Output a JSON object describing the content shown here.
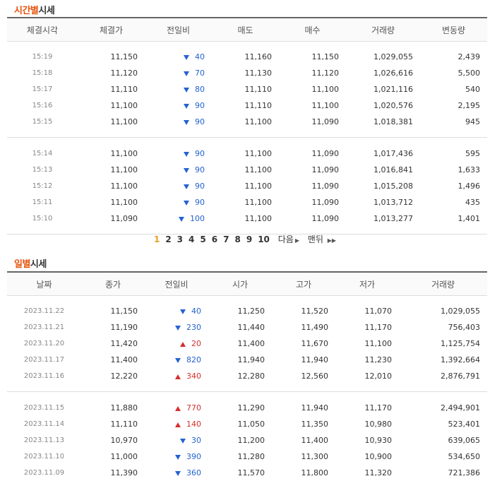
{
  "time_section": {
    "title_accent": "시간별",
    "title_rest": "시세",
    "headers": [
      "체결시각",
      "체결가",
      "전일비",
      "매도",
      "매수",
      "거래량",
      "변동량"
    ],
    "group1": [
      {
        "time": "15:19",
        "price": "11,150",
        "dir": "down",
        "change": "40",
        "ask": "11,160",
        "bid": "11,150",
        "volume": "1,029,055",
        "vchange": "2,439"
      },
      {
        "time": "15:18",
        "price": "11,120",
        "dir": "down",
        "change": "70",
        "ask": "11,130",
        "bid": "11,120",
        "volume": "1,026,616",
        "vchange": "5,500"
      },
      {
        "time": "15:17",
        "price": "11,110",
        "dir": "down",
        "change": "80",
        "ask": "11,110",
        "bid": "11,100",
        "volume": "1,021,116",
        "vchange": "540"
      },
      {
        "time": "15:16",
        "price": "11,100",
        "dir": "down",
        "change": "90",
        "ask": "11,110",
        "bid": "11,100",
        "volume": "1,020,576",
        "vchange": "2,195"
      },
      {
        "time": "15:15",
        "price": "11,100",
        "dir": "down",
        "change": "90",
        "ask": "11,100",
        "bid": "11,090",
        "volume": "1,018,381",
        "vchange": "945"
      }
    ],
    "group2": [
      {
        "time": "15:14",
        "price": "11,100",
        "dir": "down",
        "change": "90",
        "ask": "11,100",
        "bid": "11,090",
        "volume": "1,017,436",
        "vchange": "595"
      },
      {
        "time": "15:13",
        "price": "11,100",
        "dir": "down",
        "change": "90",
        "ask": "11,100",
        "bid": "11,090",
        "volume": "1,016,841",
        "vchange": "1,633"
      },
      {
        "time": "15:12",
        "price": "11,100",
        "dir": "down",
        "change": "90",
        "ask": "11,100",
        "bid": "11,090",
        "volume": "1,015,208",
        "vchange": "1,496"
      },
      {
        "time": "15:11",
        "price": "11,100",
        "dir": "down",
        "change": "90",
        "ask": "11,100",
        "bid": "11,090",
        "volume": "1,013,712",
        "vchange": "435"
      },
      {
        "time": "15:10",
        "price": "11,090",
        "dir": "down",
        "change": "100",
        "ask": "11,100",
        "bid": "11,090",
        "volume": "1,013,277",
        "vchange": "1,401"
      }
    ]
  },
  "pager": {
    "pages": [
      "1",
      "2",
      "3",
      "4",
      "5",
      "6",
      "7",
      "8",
      "9",
      "10"
    ],
    "current": "1",
    "next_label": "다음",
    "last_label": "맨뒤",
    "next_icon": "triangle-right-icon",
    "last_icon": "double-triangle-right-icon"
  },
  "daily_section": {
    "title_accent": "일별",
    "title_rest": "시세",
    "headers": [
      "날짜",
      "종가",
      "전일비",
      "시가",
      "고가",
      "저가",
      "거래량"
    ],
    "group1": [
      {
        "date": "2023.11.22",
        "close": "11,150",
        "dir": "down",
        "change": "40",
        "open": "11,250",
        "high": "11,520",
        "low": "11,070",
        "volume": "1,029,055"
      },
      {
        "date": "2023.11.21",
        "close": "11,190",
        "dir": "down",
        "change": "230",
        "open": "11,440",
        "high": "11,490",
        "low": "11,170",
        "volume": "756,403"
      },
      {
        "date": "2023.11.20",
        "close": "11,420",
        "dir": "up",
        "change": "20",
        "open": "11,400",
        "high": "11,670",
        "low": "11,100",
        "volume": "1,125,754"
      },
      {
        "date": "2023.11.17",
        "close": "11,400",
        "dir": "down",
        "change": "820",
        "open": "11,940",
        "high": "11,940",
        "low": "11,230",
        "volume": "1,392,664"
      },
      {
        "date": "2023.11.16",
        "close": "12,220",
        "dir": "up",
        "change": "340",
        "open": "12,280",
        "high": "12,560",
        "low": "12,010",
        "volume": "2,876,791"
      }
    ],
    "group2": [
      {
        "date": "2023.11.15",
        "close": "11,880",
        "dir": "up",
        "change": "770",
        "open": "11,290",
        "high": "11,940",
        "low": "11,170",
        "volume": "2,494,901"
      },
      {
        "date": "2023.11.14",
        "close": "11,110",
        "dir": "up",
        "change": "140",
        "open": "11,050",
        "high": "11,350",
        "low": "10,980",
        "volume": "523,401"
      },
      {
        "date": "2023.11.13",
        "close": "10,970",
        "dir": "down",
        "change": "30",
        "open": "11,200",
        "high": "11,400",
        "low": "10,930",
        "volume": "639,065"
      },
      {
        "date": "2023.11.10",
        "close": "11,000",
        "dir": "down",
        "change": "390",
        "open": "11,280",
        "high": "11,300",
        "low": "10,900",
        "volume": "534,650"
      },
      {
        "date": "2023.11.09",
        "close": "11,390",
        "dir": "down",
        "change": "360",
        "open": "11,570",
        "high": "11,800",
        "low": "11,320",
        "volume": "721,386"
      }
    ]
  },
  "colors": {
    "accent": "#e8510a",
    "down": "#2463d1",
    "up": "#d42f2f",
    "current_page": "#e8a021"
  }
}
